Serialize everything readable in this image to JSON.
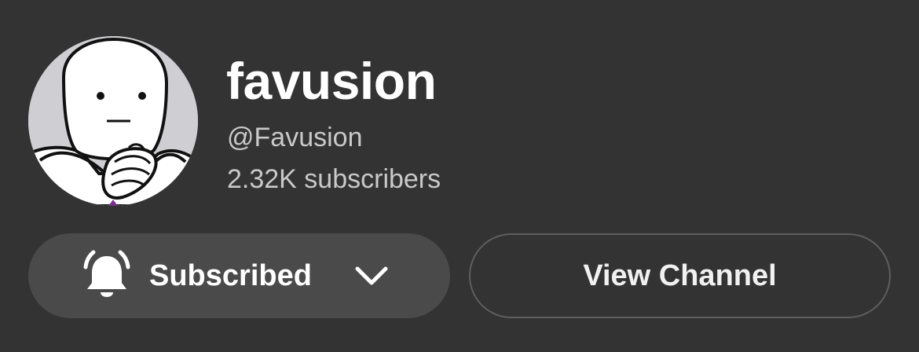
{
  "channel": {
    "name": "favusion",
    "handle": "@Favusion",
    "subscribers": "2.32K subscribers",
    "avatar_icon": "meme-character-avatar"
  },
  "actions": {
    "subscribed_label": "Subscribed",
    "subscribed_icon": "bell-icon",
    "dropdown_icon": "chevron-down-icon",
    "view_channel_label": "View Channel"
  },
  "colors": {
    "background": "#333333",
    "subscribed_button_bg": "#4a4a4a",
    "outline_button_border": "#5e5e5e",
    "secondary_text": "#c9c9c9",
    "primary_text": "#ffffff"
  }
}
